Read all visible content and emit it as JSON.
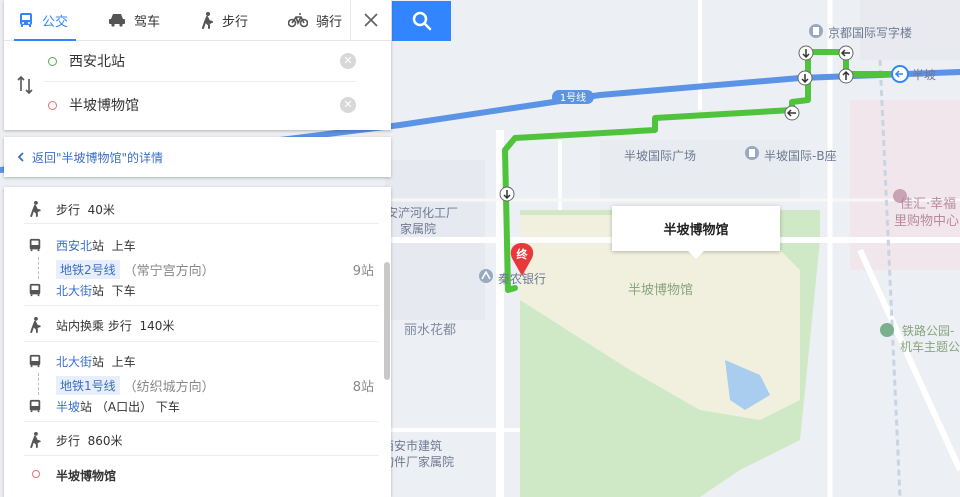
{
  "modes": [
    {
      "label": "公交",
      "icon": "bus-icon",
      "active": true
    },
    {
      "label": "驾车",
      "icon": "car-icon",
      "active": false
    },
    {
      "label": "步行",
      "icon": "walk-icon",
      "active": false
    },
    {
      "label": "骑行",
      "icon": "bike-icon",
      "active": false
    }
  ],
  "route": {
    "start": "西安北站",
    "end": "半坡博物馆",
    "start_color": "#4caf50",
    "end_color": "#e57373"
  },
  "back_link": "返回\"半坡博物馆\"的详情",
  "steps": {
    "walk1": {
      "verb": "步行",
      "dist": "40米"
    },
    "board1": {
      "station": "西安北",
      "suffix": "站",
      "action": "上车",
      "line": "地铁2号线",
      "direction": "（常宁宫方向）",
      "stops": "9站"
    },
    "alight1": {
      "station": "北大街",
      "suffix": "站",
      "action": "下车"
    },
    "transfer": {
      "text": "站内换乘",
      "verb": "步行",
      "dist": "140米"
    },
    "board2": {
      "station": "北大街",
      "suffix": "站",
      "action": "上车",
      "line": "地铁1号线",
      "direction": "（纺织城方向）",
      "stops": "8站"
    },
    "alight2": {
      "station": "半坡",
      "suffix": "站",
      "exit": "（A口出）",
      "action": "下车"
    },
    "walk2": {
      "verb": "步行",
      "dist": "860米"
    },
    "destination": "半坡博物馆"
  },
  "map": {
    "callout": "半坡博物馆",
    "end_marker": "终",
    "metro_line_label": "1号线",
    "labels": {
      "jingdu": "京都国际写字楼",
      "banpo_station": "半坡",
      "banpo_plaza": "半坡国际广场",
      "banpo_b": "半坡国际-B座",
      "anchan1": "安浐河化工厂",
      "anchan2": "家属院",
      "bank": "秦农银行",
      "museum_area": "半坡博物馆",
      "lishui": "丽水花都",
      "jiahui1": "佳汇·幸福",
      "jiahui2": "里购物中心",
      "park1": "铁路公园-",
      "park2": "机车主题公",
      "jianzhu1": "西安市建筑",
      "jianzhu2": "构件厂家属院"
    },
    "colors": {
      "route": "#4fc33c",
      "metro": "#5b93e6",
      "accent": "#3385ff"
    }
  }
}
